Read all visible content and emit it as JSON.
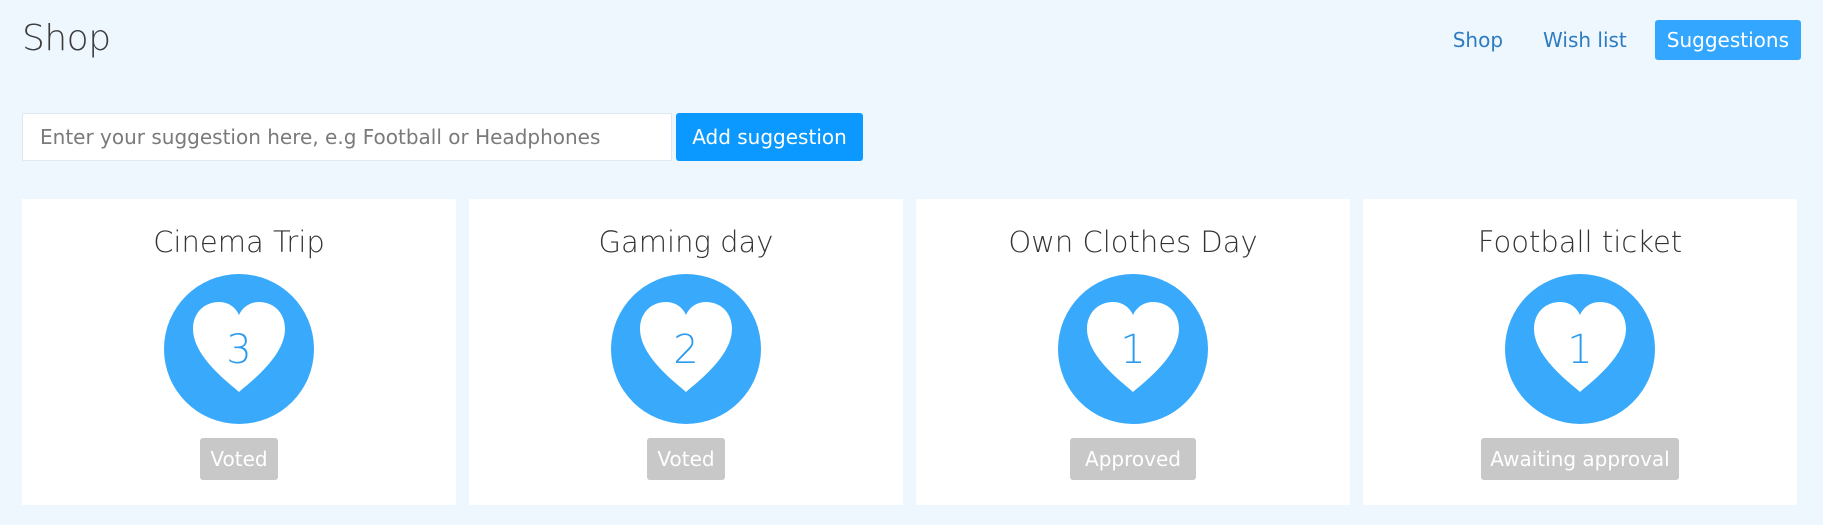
{
  "header": {
    "title": "Shop",
    "nav": [
      {
        "label": "Shop"
      },
      {
        "label": "Wish list"
      },
      {
        "label": "Suggestions"
      }
    ]
  },
  "form": {
    "placeholder": "Enter your suggestion here, e.g Football or Headphones",
    "value": "",
    "add_label": "Add suggestion"
  },
  "cards": [
    {
      "title": "Cinema Trip",
      "votes": "3",
      "status": "Voted"
    },
    {
      "title": "Gaming day",
      "votes": "2",
      "status": "Voted"
    },
    {
      "title": "Own Clothes Day",
      "votes": "1",
      "status": "Approved"
    },
    {
      "title": "Football ticket",
      "votes": "1",
      "status": "Awaiting approval"
    }
  ],
  "icons": {
    "vote": "heart-icon"
  },
  "colors": {
    "page_background": "#eef6fe",
    "accent": "#0b99ff",
    "active_nav": "#33a7ff",
    "vote_circle": "#38a9fb",
    "vote_count": "#2c9cf0",
    "status_badge": "#c8c8c8"
  }
}
